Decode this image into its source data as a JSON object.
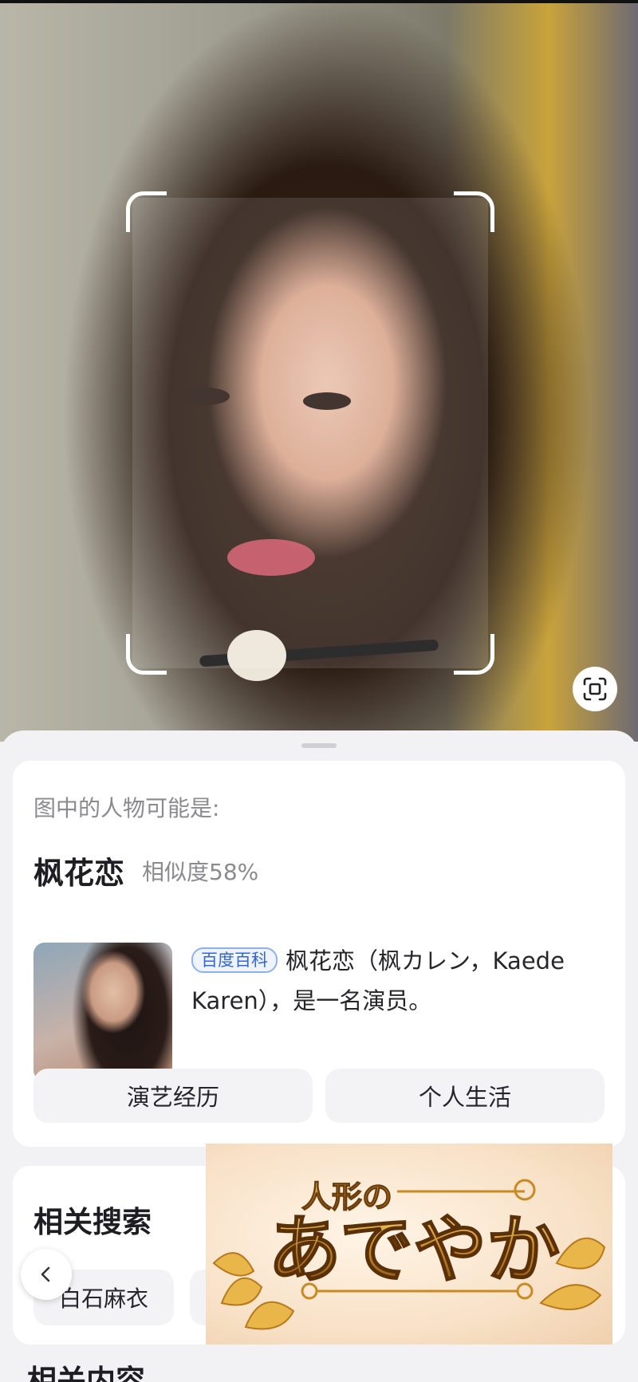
{
  "result": {
    "caption": "图中的人物可能是:",
    "name": "枫花恋",
    "similarity": "相似度58%",
    "source_badge": "百度百科",
    "description": "枫花恋（枫カレン，Kaede Karen），是一名演员。",
    "chips": [
      "演艺经历",
      "个人生活"
    ]
  },
  "related_search": {
    "title": "相关搜索",
    "tags": [
      "白石麻衣"
    ]
  },
  "related_content": {
    "title": "相关内容"
  },
  "ad": {
    "text_top": "人形の",
    "text_main": "あでやか"
  },
  "icons": {
    "scan": "scan-frame-icon",
    "back": "chevron-left-icon"
  },
  "colors": {
    "badge": "#3466d6",
    "frame": "#ffffff",
    "ad_gold": "#b77a1e"
  }
}
